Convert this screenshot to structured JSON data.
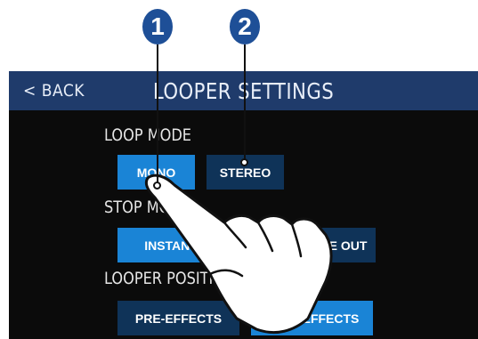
{
  "callouts": [
    "1",
    "2"
  ],
  "header": {
    "back_label": "< BACK",
    "title": "LOOPER SETTINGS"
  },
  "loop_mode": {
    "label": "LOOP MODE",
    "options": [
      "MONO",
      "STEREO"
    ],
    "selected": "MONO"
  },
  "stop_mode": {
    "label": "STOP MODE",
    "options": [
      "INSTANT",
      "FADE OUT"
    ],
    "selected": "INSTANT"
  },
  "looper_position": {
    "label": "LOOPER POSITION",
    "options": [
      "PRE-EFFECTS",
      "POST-EFFECTS"
    ],
    "selected": "POST-EFFECTS"
  },
  "colors": {
    "header": "#1f3b6b",
    "selected": "#1a84d6",
    "unselected": "#0f3358",
    "callout": "#1e4f97"
  },
  "icons": {
    "hand": "pointing-hand-icon"
  }
}
